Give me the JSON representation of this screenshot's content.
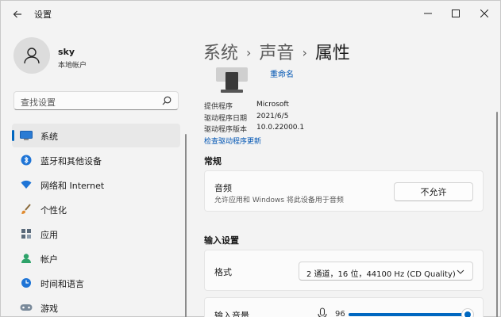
{
  "window": {
    "app_title": "设置",
    "controls": {
      "minimize": "—",
      "maximize": "☐",
      "close": "✕"
    }
  },
  "profile": {
    "name": "sky",
    "account_type": "本地帐户"
  },
  "search": {
    "placeholder": "查找设置"
  },
  "sidebar": {
    "items": [
      {
        "label": "系统",
        "icon": "system-icon",
        "active": true
      },
      {
        "label": "蓝牙和其他设备",
        "icon": "bluetooth-icon"
      },
      {
        "label": "网络和 Internet",
        "icon": "wifi-icon"
      },
      {
        "label": "个性化",
        "icon": "brush-icon"
      },
      {
        "label": "应用",
        "icon": "apps-icon"
      },
      {
        "label": "帐户",
        "icon": "account-icon"
      },
      {
        "label": "时间和语言",
        "icon": "clock-icon"
      },
      {
        "label": "游戏",
        "icon": "gamepad-icon"
      }
    ]
  },
  "breadcrumb": {
    "part1": "系统",
    "part2": "声音",
    "current": "属性"
  },
  "device": {
    "rename_link": "重命名",
    "props": [
      {
        "label": "提供程序",
        "value": "Microsoft"
      },
      {
        "label": "驱动程序日期",
        "value": "2021/6/5"
      },
      {
        "label": "驱动程序版本",
        "value": "10.0.22000.1"
      }
    ],
    "update_link": "检查驱动程序更新"
  },
  "general": {
    "section_title": "常规",
    "audio_title": "音频",
    "audio_desc": "允许应用和 Windows 将此设备用于音频",
    "audio_button": "不允许"
  },
  "input_settings": {
    "section_title": "输入设置",
    "format_label": "格式",
    "format_value": "2 通道，16 位，44100 Hz (CD Quality)",
    "volume_label": "输入音量",
    "volume_value": "96",
    "volume_level": 0.96
  },
  "colors": {
    "accent": "#0067c0",
    "link": "#0055b3",
    "background": "#f3f3f3"
  }
}
